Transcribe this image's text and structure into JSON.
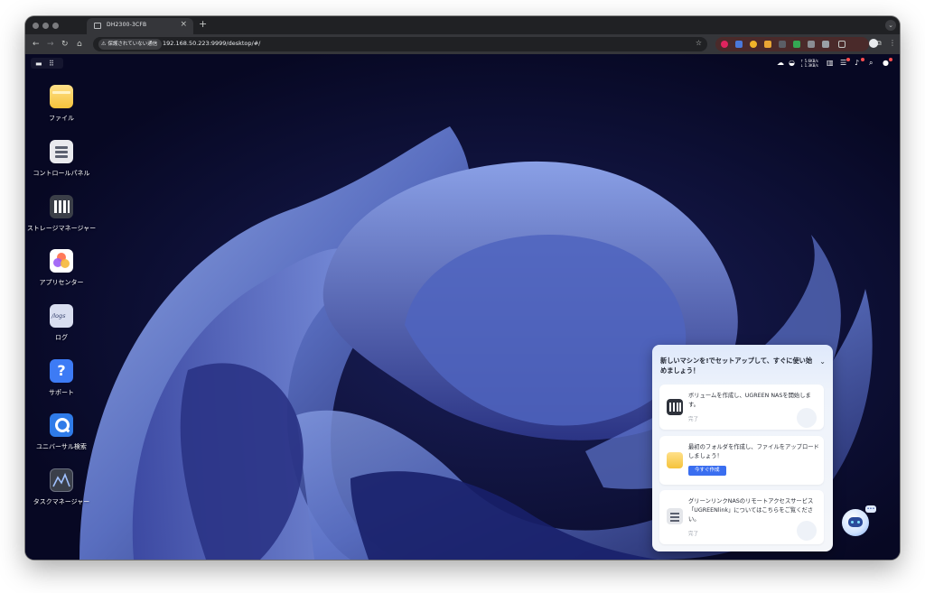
{
  "browser": {
    "tab_title": "DH2300-3CFB",
    "tab_close": "×",
    "new_tab": "+",
    "security_label": "保護されていない通信",
    "url": "192.168.50.223:9999/desktop/#/"
  },
  "tray": {
    "upload_speed": "↑ 5.6KB/s",
    "download_speed": "↓ 1.3KB/s"
  },
  "desktop_icons": [
    {
      "label": "ファイル",
      "icon": "folder-icon"
    },
    {
      "label": "コントロールパネル",
      "icon": "control-panel-icon"
    },
    {
      "label": "ストレージマネージャー",
      "icon": "storage-icon"
    },
    {
      "label": "アプリセンター",
      "icon": "app-center-icon"
    },
    {
      "label": "ログ",
      "icon": "logs-icon",
      "tile_text": "/logs"
    },
    {
      "label": "サポート",
      "icon": "support-icon",
      "tile_text": "?"
    },
    {
      "label": "ユニバーサル検索",
      "icon": "search-icon"
    },
    {
      "label": "タスクマネージャー",
      "icon": "task-manager-icon"
    }
  ],
  "setup_panel": {
    "title": "新しいマシンを!でセットアップして、すぐに使い始めましょう！",
    "cards": [
      {
        "text": "ボリュームを作成し、UGREEN NASを開始します。",
        "status": "完了"
      },
      {
        "text": "最初のフォルダを作成し、ファイルをアップロードしましょう！",
        "button": "今すぐ作成"
      },
      {
        "text": "グリーンリンクNASのリモートアクセスサービス「UGREENlink」についてはこちらをご覧ください。",
        "status": "完了"
      }
    ]
  },
  "colors": {
    "accent": "#3a6ef0",
    "desktop_bg": "#0a0b28",
    "browser_chrome": "#35363a"
  }
}
